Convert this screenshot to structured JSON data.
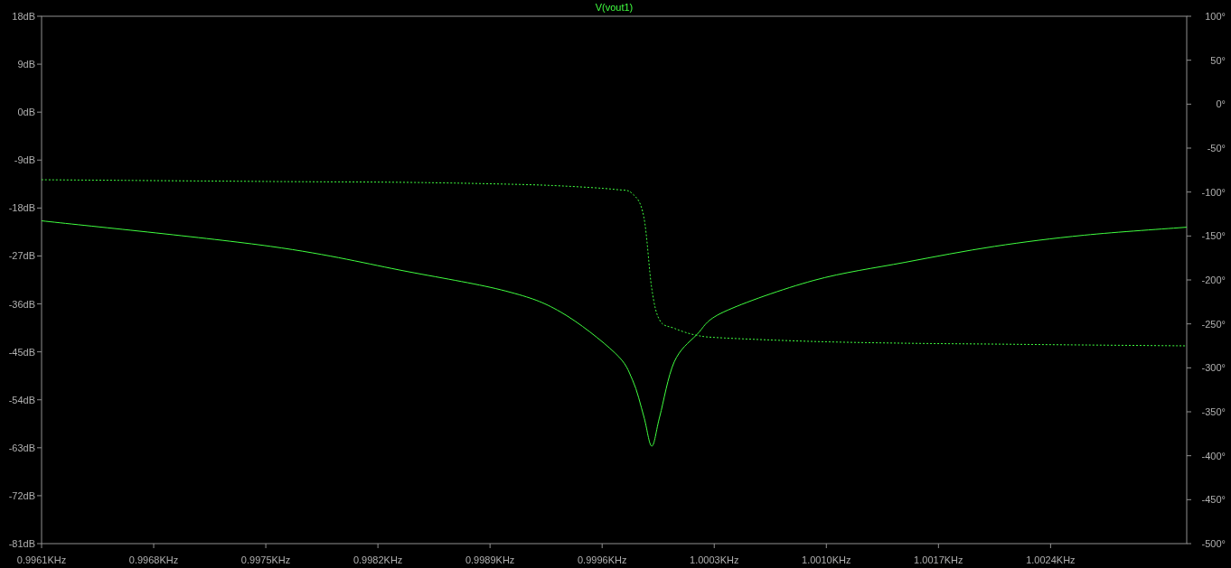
{
  "plot": {
    "chart_data": {
      "type": "line",
      "title": "V(vout1)",
      "x": [
        0.9961,
        0.99753,
        0.99838,
        0.999,
        0.99934,
        0.99968,
        0.99979,
        0.99986,
        0.99991,
        0.99996,
        1.00005,
        1.00019,
        1.00036,
        1.00092,
        1.00149,
        1.00205,
        1.00261,
        1.00325
      ],
      "series": [
        {
          "color": "#40ff40",
          "values": [
            -20.4,
            -25.2,
            -29.9,
            -33.6,
            -37.5,
            -45.2,
            -50.3,
            -57.1,
            -62.7,
            -57.1,
            -46.9,
            -41.8,
            -37.5,
            -31.6,
            -28.2,
            -25.2,
            -23.1,
            -21.6
          ]
        },
        {
          "color": "#40ff40",
          "axis": "y2",
          "line_style": "dashed",
          "values": [
            -86,
            -88,
            -89,
            -91,
            -93,
            -97,
            -102,
            -128,
            -210,
            -246,
            -255,
            -263,
            -266,
            -270,
            -272,
            -273,
            -274,
            -275
          ]
        }
      ],
      "xlim": [
        0.9961,
        1.00325
      ],
      "ylim": [
        -81,
        18
      ],
      "y2lim": [
        -500,
        100
      ],
      "xticks": [
        {
          "value": 0.9961,
          "label": "0.9961KHz"
        },
        {
          "value": 0.9968,
          "label": "0.9968KHz"
        },
        {
          "value": 0.9975,
          "label": "0.9975KHz"
        },
        {
          "value": 0.9982,
          "label": "0.9982KHz"
        },
        {
          "value": 0.9989,
          "label": "0.9989KHz"
        },
        {
          "value": 0.9996,
          "label": "0.9996KHz"
        },
        {
          "value": 1.0003,
          "label": "1.0003KHz"
        },
        {
          "value": 1.001,
          "label": "1.0010KHz"
        },
        {
          "value": 1.0017,
          "label": "1.0017KHz"
        },
        {
          "value": 1.0024,
          "label": "1.0024KHz"
        }
      ],
      "yticks": [
        {
          "value": 18,
          "label": "18dB"
        },
        {
          "value": 9,
          "label": "9dB"
        },
        {
          "value": 0,
          "label": "0dB"
        },
        {
          "value": -9,
          "label": "-9dB"
        },
        {
          "value": -18,
          "label": "-18dB"
        },
        {
          "value": -27,
          "label": "-27dB"
        },
        {
          "value": -36,
          "label": "-36dB"
        },
        {
          "value": -45,
          "label": "-45dB"
        },
        {
          "value": -54,
          "label": "-54dB"
        },
        {
          "value": -63,
          "label": "-63dB"
        },
        {
          "value": -72,
          "label": "-72dB"
        },
        {
          "value": -81,
          "label": "-81dB"
        }
      ],
      "y2ticks": [
        {
          "value": 100,
          "label": "100°"
        },
        {
          "value": 50,
          "label": "50°"
        },
        {
          "value": 0,
          "label": "0°"
        },
        {
          "value": -50,
          "label": "-50°"
        },
        {
          "value": -100,
          "label": "-100°"
        },
        {
          "value": -150,
          "label": "-150°"
        },
        {
          "value": -200,
          "label": "-200°"
        },
        {
          "value": -250,
          "label": "-250°"
        },
        {
          "value": -300,
          "label": "-300°"
        },
        {
          "value": -350,
          "label": "-350°"
        },
        {
          "value": -400,
          "label": "-400°"
        },
        {
          "value": -450,
          "label": "-450°"
        },
        {
          "value": -500,
          "label": "-500°"
        }
      ]
    }
  }
}
